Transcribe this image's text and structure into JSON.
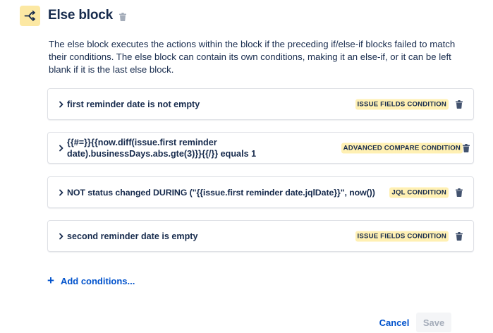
{
  "header": {
    "title": "Else block",
    "icon": "branch-icon",
    "icon_bg": "#fce8a3",
    "delete_icon": "trash-icon"
  },
  "description": "The else block executes the actions within the block if the preceding if/else-if blocks failed to match their conditions. The else block can contain its own conditions, making it an else-if, or it can be left blank if it is the last else block.",
  "conditions": [
    {
      "text": "first reminder date is not empty",
      "badge": "ISSUE FIELDS CONDITION"
    },
    {
      "text_line1": "{{#=}}{{now.diff(issue.first reminder",
      "text_line2": "date).businessDays.abs.gte(3)}}{{/}} equals 1",
      "badge": "ADVANCED COMPARE CONDITION"
    },
    {
      "text": "NOT status changed DURING (\"{{issue.first reminder date.jqlDate}}\", now())",
      "badge": "JQL CONDITION"
    },
    {
      "text": "second reminder date is empty",
      "badge": "ISSUE FIELDS CONDITION"
    }
  ],
  "add_conditions": {
    "plus": "+",
    "label": "Add conditions..."
  },
  "footer": {
    "cancel_label": "Cancel",
    "save_label": "Save"
  },
  "colors": {
    "link": "#0052cc",
    "badge_bg": "#fff0b3",
    "text": "#172b4d",
    "disabled_text": "#a5adba"
  }
}
